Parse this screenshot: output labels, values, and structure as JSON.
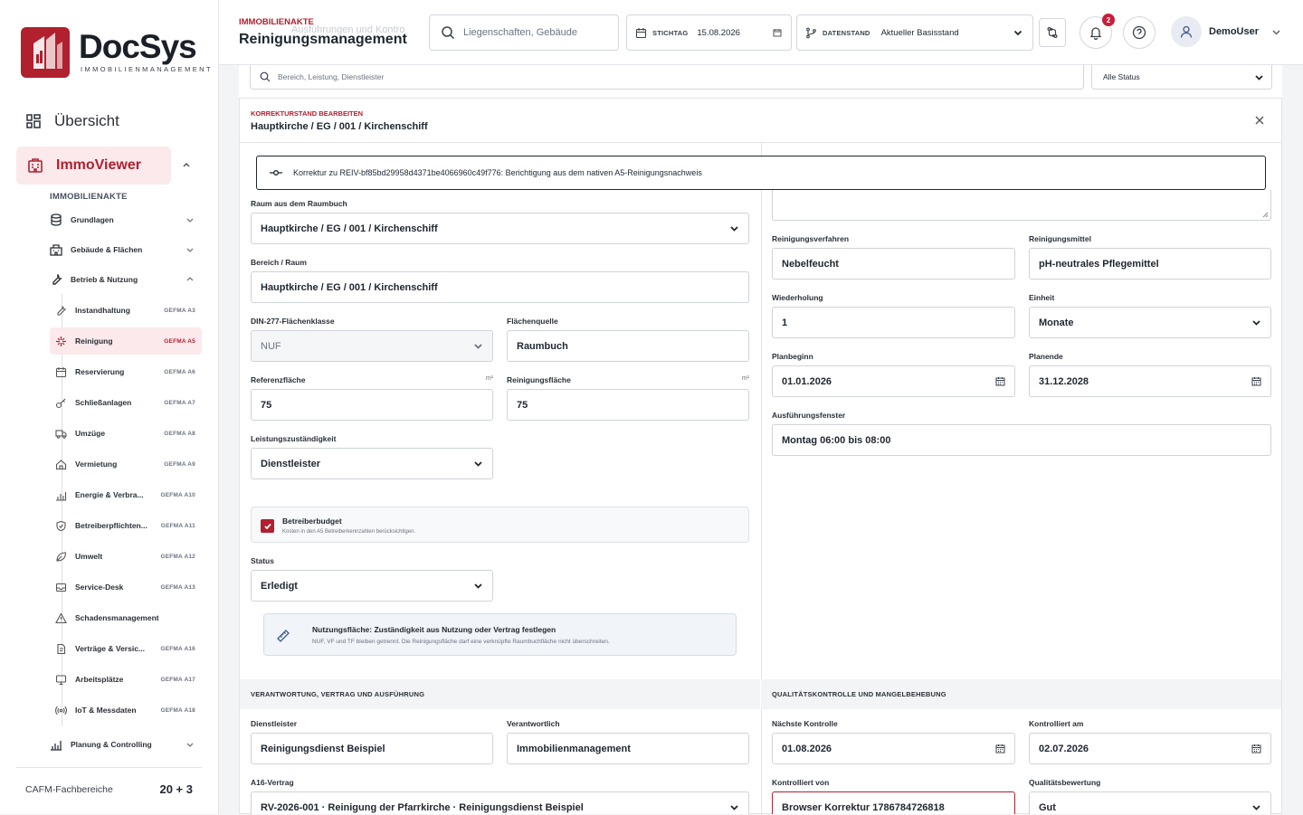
{
  "brand": {
    "name": "DocSys",
    "tagline": "IMMOBILIENMANAGEMENT"
  },
  "sidebar": {
    "overview_label": "Übersicht",
    "immo_label": "ImmoViewer",
    "section_label": "IMMOBILIENAKTE",
    "groups": [
      {
        "label": "Grundlagen",
        "icon": "database-icon"
      },
      {
        "label": "Gebäude & Flächen",
        "icon": "building-icon"
      },
      {
        "label": "Betrieb & Nutzung",
        "icon": "wrench-icon"
      }
    ],
    "items": [
      {
        "label": "Instandhaltung",
        "code": "GEFMA A3"
      },
      {
        "label": "Reinigung",
        "code": "GEFMA A5"
      },
      {
        "label": "Reservierung",
        "code": "GEFMA A6"
      },
      {
        "label": "Schließanlagen",
        "code": "GEFMA A7"
      },
      {
        "label": "Umzüge",
        "code": "GEFMA A8"
      },
      {
        "label": "Vermietung",
        "code": "GEFMA A9"
      },
      {
        "label": "Energie & Verbra...",
        "code": "GEFMA A10"
      },
      {
        "label": "Betreiberpflichten...",
        "code": "GEFMA A11"
      },
      {
        "label": "Umwelt",
        "code": "GEFMA A12"
      },
      {
        "label": "Service-Desk",
        "code": "GEFMA A13"
      },
      {
        "label": "Schadensmanagement",
        "code": ""
      },
      {
        "label": "Verträge & Versic...",
        "code": "GEFMA A16"
      },
      {
        "label": "Arbeitsplätze",
        "code": "GEFMA A17"
      },
      {
        "label": "IoT & Messdaten",
        "code": "GEFMA A18"
      }
    ],
    "planning_label": "Planung & Controlling",
    "footer_label": "CAFM-Fachbereiche",
    "footer_count": "20 + 3"
  },
  "header": {
    "kicker": "IMMOBILIENAKTE",
    "title": "Reinigungsmanagement",
    "ghost_text": "Ausführungen und Kontro",
    "search_placeholder": "Liegenschaften, Gebäude",
    "stichtag_label": "STICHTAG",
    "stichtag_value": "15.08.2026",
    "datenstand_label": "DATENSTAND",
    "datenstand_value": "Aktueller Basisstand",
    "notification_count": "2",
    "user_name": "DemoUser"
  },
  "filter": {
    "search_placeholder": "Bereich, Leistung, Dienstleister",
    "status_value": "Alle Status"
  },
  "panel": {
    "kicker": "KORREKTURSTAND BEARBEITEN",
    "title": "Hauptkirche / EG / 001 / Kirchenschiff",
    "tooltip": "Korrektur zu REIV-bf85bd29958d4371be4066960c49f776: Berichtigung aus dem nativen A5-Reinigungsnachweis"
  },
  "form_left": {
    "raum_label": "Raum aus dem Raumbuch",
    "raum_value": "Hauptkirche / EG / 001 / Kirchenschiff",
    "bereich_label": "Bereich / Raum",
    "bereich_value": "Hauptkirche / EG / 001 / Kirchenschiff",
    "din_label": "DIN-277-Flächenklasse",
    "din_value": "NUF",
    "quelle_label": "Flächenquelle",
    "quelle_value": "Raumbuch",
    "ref_label": "Referenzfläche",
    "ref_unit": "m²",
    "ref_value": "75",
    "rein_label": "Reinigungsfläche",
    "rein_unit": "m²",
    "rein_value": "75",
    "zust_label": "Leistungszuständigkeit",
    "zust_value": "Dienstleister",
    "budget_title": "Betreiberbudget",
    "budget_sub": "Kosten in den A5 Betreiberkennzahlen berücksichtigen.",
    "status_label": "Status",
    "status_value": "Erledigt",
    "info_title": "Nutzungsfläche: Zuständigkeit aus Nutzung oder Vertrag festlegen",
    "info_sub": "NUF, VF und TF bleiben getrennt. Die Reinigungsfläche darf eine verknüpfte Raumbuchfläche nicht überschreiten."
  },
  "form_right": {
    "verfahren_label": "Reinigungsverfahren",
    "verfahren_value": "Nebelfeucht",
    "mittel_label": "Reinigungsmittel",
    "mittel_value": "pH-neutrales Pflegemittel",
    "wdh_label": "Wiederholung",
    "wdh_value": "1",
    "einheit_label": "Einheit",
    "einheit_value": "Monate",
    "planbeginn_label": "Planbeginn",
    "planbeginn_value": "01.01.2026",
    "planende_label": "Planende",
    "planende_value": "31.12.2028",
    "fenster_label": "Ausführungsfenster",
    "fenster_value": "Montag 06:00 bis 08:00"
  },
  "section_left": {
    "title": "VERANTWORTUNG, VERTRAG UND AUSFÜHRUNG",
    "dl_label": "Dienstleister",
    "dl_value": "Reinigungsdienst Beispiel",
    "verantw_label": "Verantwortlich",
    "verantw_value": "Immobilienmanagement",
    "vertrag_label": "A16-Vertrag",
    "vertrag_value": "RV-2026-001 · Reinigung der Pfarrkirche · Reinigungsdienst Beispiel"
  },
  "section_right": {
    "title": "QUALITÄTSKONTROLLE UND MANGELBEHEBUNG",
    "next_label": "Nächste Kontrolle",
    "next_value": "01.08.2026",
    "done_label": "Kontrolliert am",
    "done_value": "02.07.2026",
    "by_label": "Kontrolliert von",
    "by_value": "Browser Korrektur 1786784726818",
    "quality_label": "Qualitätsbewertung",
    "quality_value": "Gut"
  },
  "colors": {
    "accent": "#b0202f",
    "accent_light": "#fbe9ec",
    "text": "#1f2630"
  }
}
